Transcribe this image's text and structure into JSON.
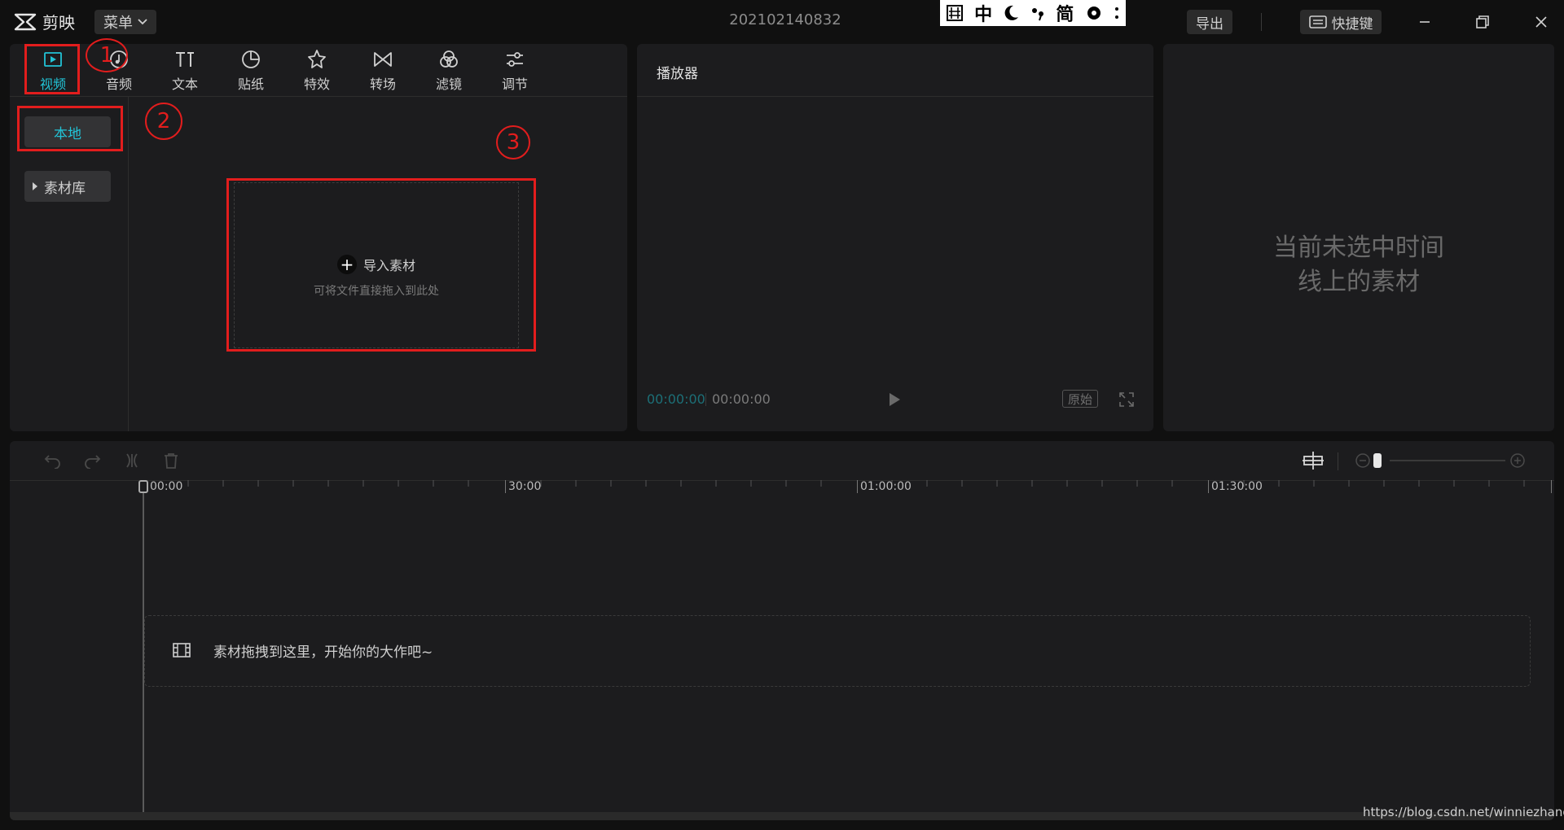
{
  "app": {
    "name": "剪映",
    "menu_label": "菜单",
    "project_title": "202102140832",
    "export_label": "导出",
    "shortcut_label": "快捷键",
    "ime": [
      "中",
      "简"
    ]
  },
  "media": {
    "tabs": [
      {
        "label": "视频",
        "icon": "video-play-icon",
        "active": true
      },
      {
        "label": "音频",
        "icon": "music-note-icon"
      },
      {
        "label": "文本",
        "icon": "text-icon"
      },
      {
        "label": "贴纸",
        "icon": "sticker-icon"
      },
      {
        "label": "特效",
        "icon": "effects-star-icon"
      },
      {
        "label": "转场",
        "icon": "transition-icon"
      },
      {
        "label": "滤镜",
        "icon": "filter-icon"
      },
      {
        "label": "调节",
        "icon": "adjust-sliders-icon"
      }
    ],
    "sidebar": {
      "local_label": "本地",
      "library_label": "素材库"
    },
    "import": {
      "label": "导入素材",
      "hint": "可将文件直接拖入到此处"
    }
  },
  "annotations": {
    "one": "1",
    "two": "2",
    "three": "3"
  },
  "player": {
    "title": "播放器",
    "current_time": "00:00:00",
    "total_time": "00:00:00",
    "original_label": "原始"
  },
  "props": {
    "empty_line1": "当前未选中时间",
    "empty_line2": "线上的素材"
  },
  "timeline": {
    "ticks": [
      "00:00",
      "30:00",
      "01:00:00",
      "01:30:00"
    ],
    "drop_text": "素材拖拽到这里，开始你的大作吧~"
  },
  "watermark": "https://blog.csdn.net/winniezhang",
  "colors": {
    "accent": "#22c3d6",
    "annotation": "#e21d1d",
    "panel": "#1c1c1e",
    "background": "#101010"
  }
}
